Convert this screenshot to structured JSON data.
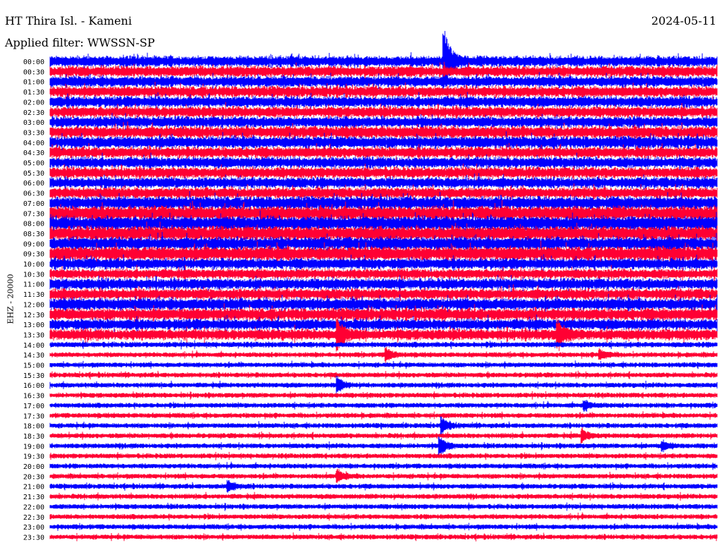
{
  "header": {
    "station": "HT Thira Isl. - Kameni",
    "filter": "Applied filter: WWSSN-SP",
    "date": "2024-05-11"
  },
  "chart_data": {
    "type": "line",
    "title": "HT Thira Isl. - Kameni",
    "ylabel": "EHZ - 20000",
    "row_minutes": 30,
    "row_labels": [
      "00:00",
      "00:30",
      "01:00",
      "01:30",
      "02:00",
      "02:30",
      "03:00",
      "03:30",
      "04:00",
      "04:30",
      "05:00",
      "05:30",
      "06:00",
      "06:30",
      "07:00",
      "07:30",
      "08:00",
      "08:30",
      "09:00",
      "09:30",
      "10:00",
      "10:30",
      "11:00",
      "11:30",
      "12:00",
      "12:30",
      "13:00",
      "13:30",
      "14:00",
      "14:30",
      "15:00",
      "15:30",
      "16:00",
      "16:30",
      "17:00",
      "17:30",
      "18:00",
      "18:30",
      "19:00",
      "19:30",
      "20:00",
      "20:30",
      "21:00",
      "21:30",
      "22:00",
      "22:30",
      "23:00",
      "23:30"
    ],
    "colors": [
      "#0000ff",
      "#ff0033"
    ],
    "noise_level": [
      1.0,
      1.0,
      1.0,
      1.0,
      1.0,
      1.0,
      1.0,
      1.1,
      1.1,
      1.0,
      1.0,
      1.0,
      1.0,
      1.0,
      1.2,
      1.3,
      1.3,
      1.3,
      1.2,
      1.3,
      1.0,
      0.9,
      1.0,
      1.0,
      1.1,
      1.1,
      1.0,
      1.0,
      0.5,
      0.45,
      0.45,
      0.45,
      0.45,
      0.45,
      0.45,
      0.45,
      0.45,
      0.45,
      0.45,
      0.45,
      0.45,
      0.45,
      0.45,
      0.45,
      0.45,
      0.45,
      0.45,
      0.45
    ],
    "events": [
      {
        "row": 0,
        "minute": 17.7,
        "strength": 5.0
      },
      {
        "row": 27,
        "minute": 12.9,
        "strength": 2.2
      },
      {
        "row": 27,
        "minute": 22.8,
        "strength": 2.0
      },
      {
        "row": 29,
        "minute": 15.1,
        "strength": 2.2
      },
      {
        "row": 29,
        "minute": 24.7,
        "strength": 1.8
      },
      {
        "row": 32,
        "minute": 12.9,
        "strength": 2.5
      },
      {
        "row": 34,
        "minute": 24.0,
        "strength": 1.6
      },
      {
        "row": 36,
        "minute": 17.6,
        "strength": 2.5
      },
      {
        "row": 37,
        "minute": 23.9,
        "strength": 2.2
      },
      {
        "row": 38,
        "minute": 17.5,
        "strength": 3.2
      },
      {
        "row": 38,
        "minute": 27.5,
        "strength": 1.5
      },
      {
        "row": 41,
        "minute": 12.9,
        "strength": 2.0
      },
      {
        "row": 42,
        "minute": 8.0,
        "strength": 1.8
      }
    ]
  }
}
